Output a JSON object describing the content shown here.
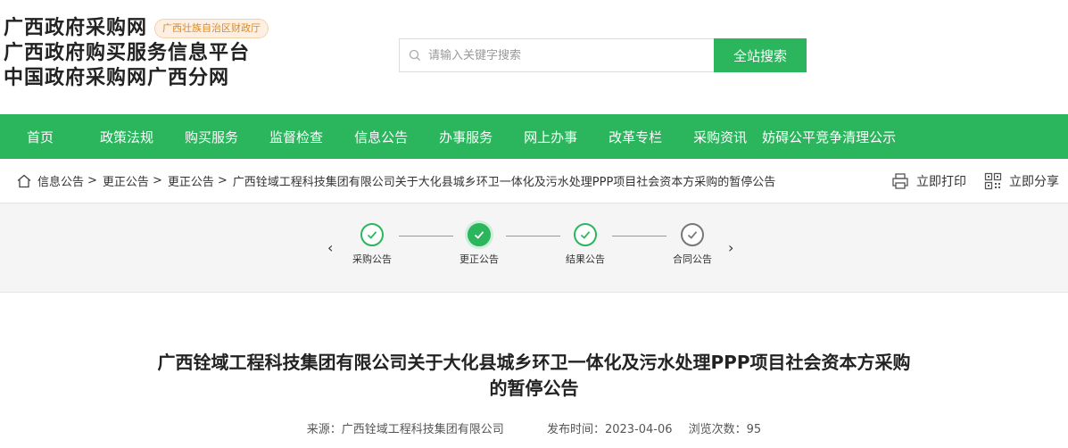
{
  "header": {
    "brand_line1": "广西政府采购网",
    "dept_badge": "广西壮族自治区财政厅",
    "brand_line2": "广西政府购买服务信息平台",
    "brand_line3": "中国政府采购网广西分网",
    "search_placeholder": "请输入关键字搜索",
    "search_button": "全站搜索"
  },
  "nav": [
    "首页",
    "政策法规",
    "购买服务",
    "监督检查",
    "信息公告",
    "办事服务",
    "网上办事",
    "改革专栏",
    "采购资讯",
    "妨碍公平竞争清理公示"
  ],
  "breadcrumb": {
    "items": [
      "信息公告",
      "更正公告",
      "更正公告"
    ],
    "current": "广西铨域工程科技集团有限公司关于大化县城乡环卫一体化及污水处理PPP项目社会资本方采购的暂停公告",
    "separator": ">"
  },
  "tools": {
    "print": "立即打印",
    "share": "立即分享"
  },
  "steps": [
    {
      "label": "采购公告",
      "state": "done"
    },
    {
      "label": "更正公告",
      "state": "active"
    },
    {
      "label": "结果公告",
      "state": "done"
    },
    {
      "label": "合同公告",
      "state": "pending"
    }
  ],
  "article": {
    "title_line1": "广西铨域工程科技集团有限公司关于大化县城乡环卫一体化及污水处理PPP项目社会资本方采购",
    "title_line2": "的暂停公告",
    "source": "来源：广西铨域工程科技集团有限公司",
    "publish_time": "发布时间：2023-04-06",
    "views": "浏览次数：95"
  },
  "colors": {
    "accent": "#2bb55c",
    "badge_text": "#d98a2b"
  }
}
